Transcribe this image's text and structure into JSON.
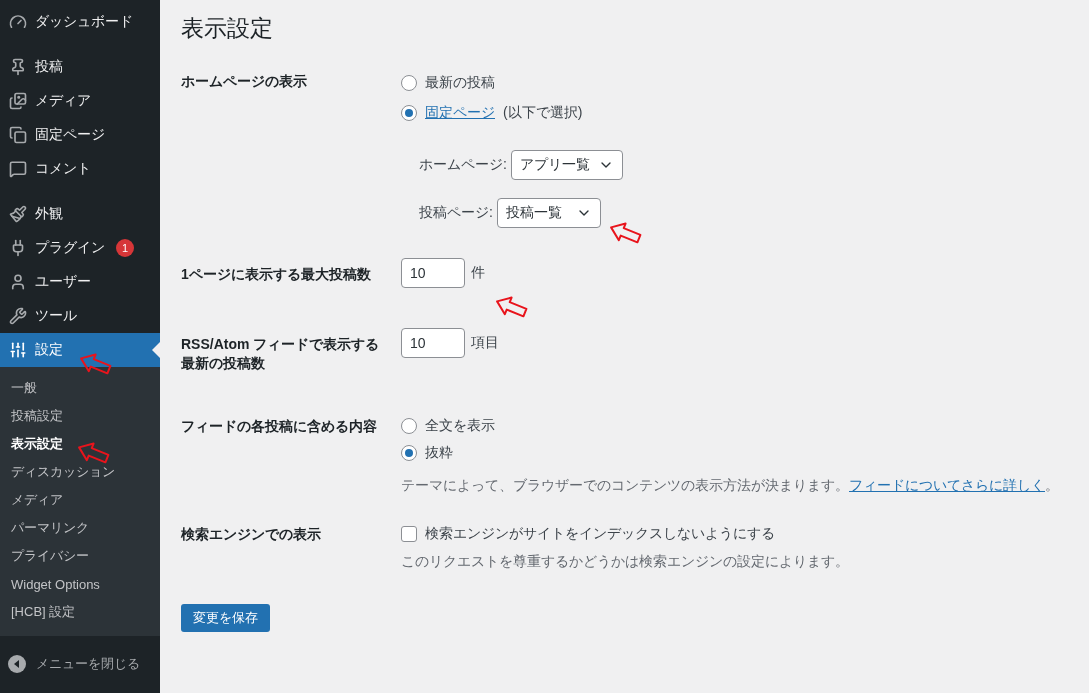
{
  "sidebar": {
    "menu": [
      [
        {
          "label": "ダッシュボード",
          "selected": false
        }
      ],
      [
        {
          "label": "投稿",
          "selected": false
        },
        {
          "label": "メディア",
          "selected": false
        },
        {
          "label": "固定ページ",
          "selected": false
        },
        {
          "label": "コメント",
          "selected": false
        }
      ],
      [
        {
          "label": "外観",
          "selected": false
        },
        {
          "label": "プラグイン",
          "badge": "1",
          "selected": false
        },
        {
          "label": "ユーザー",
          "selected": false
        },
        {
          "label": "ツール",
          "selected": false
        },
        {
          "label": "設定",
          "selected": true,
          "submenu": [
            {
              "label": "一般",
              "selected": false
            },
            {
              "label": "投稿設定",
              "selected": false
            },
            {
              "label": "表示設定",
              "selected": true
            },
            {
              "label": "ディスカッション",
              "selected": false
            },
            {
              "label": "メディア",
              "selected": false
            },
            {
              "label": "パーマリンク",
              "selected": false
            },
            {
              "label": "プライバシー",
              "selected": false
            },
            {
              "label": "Widget Options",
              "selected": false
            },
            {
              "label": "[HCB] 設定",
              "selected": false
            }
          ]
        }
      ]
    ],
    "collapse": "メニューを閉じる"
  },
  "main": {
    "title": "表示設定",
    "rows": [
      {
        "kind": "radio",
        "label": "ホームページの表示",
        "options": [
          {
            "label": "最新の投稿",
            "selected": false
          },
          {
            "link": "固定ページ",
            "label": "(以下で選択)",
            "selected": true
          }
        ],
        "selects": [
          {
            "label": "ホームページ:",
            "value": "アプリ一覧"
          },
          {
            "label": "投稿ページ:",
            "value": "投稿一覧"
          }
        ]
      },
      {
        "kind": "number",
        "label": "1ページに表示する最大投稿数",
        "value": "10",
        "unit": "件"
      },
      {
        "kind": "number",
        "label": "RSS/Atom フィードで表示する最新の投稿数",
        "value": "10",
        "unit": "項目"
      },
      {
        "kind": "radio",
        "label": "フィードの各投稿に含める内容",
        "options": [
          {
            "label": "全文を表示",
            "selected": false
          },
          {
            "label": "抜粋",
            "selected": true
          }
        ],
        "description": {
          "text": "テーマによって、ブラウザーでのコンテンツの表示方法が決まります。",
          "link": "フィードについてさらに詳しく",
          "after": "。"
        }
      },
      {
        "kind": "checkbox",
        "label": "検索エンジンでの表示",
        "checkbox": {
          "label": "検索エンジンがサイトをインデックスしないようにする",
          "checked": false
        },
        "description": {
          "text": "このリクエストを尊重するかどうかは検索エンジンの設定によります。"
        }
      }
    ],
    "save_button": "変更を保存"
  }
}
